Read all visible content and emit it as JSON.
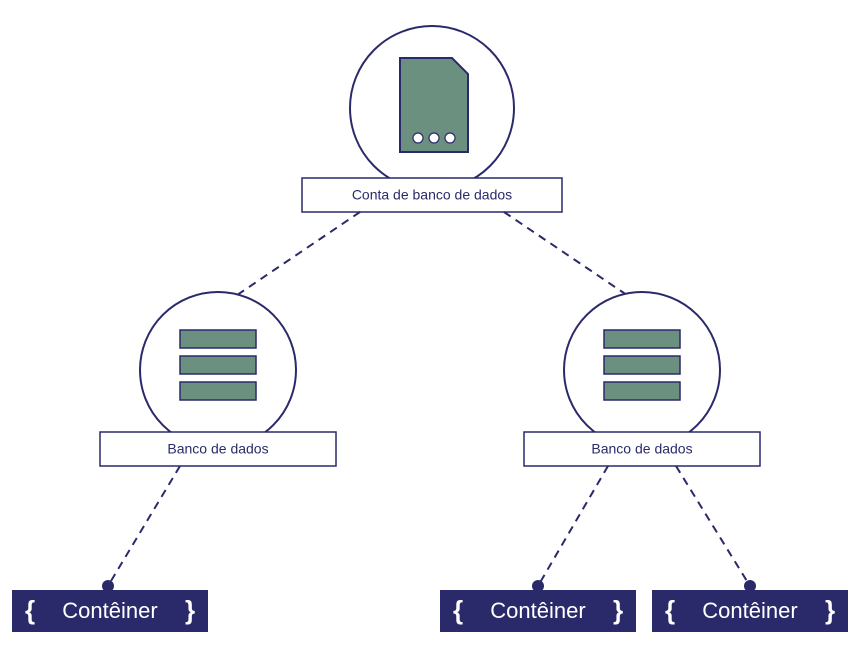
{
  "diagram": {
    "account": {
      "label": "Conta de banco de dados"
    },
    "databases": [
      {
        "label": "Banco de dados"
      },
      {
        "label": "Banco de dados"
      }
    ],
    "containers": [
      {
        "brace_left": "{",
        "label": "Contêiner",
        "brace_right": "}"
      },
      {
        "brace_left": "{",
        "label": "Contêiner",
        "brace_right": "}"
      },
      {
        "brace_left": "{",
        "label": "Contêiner",
        "brace_right": "}"
      }
    ]
  }
}
